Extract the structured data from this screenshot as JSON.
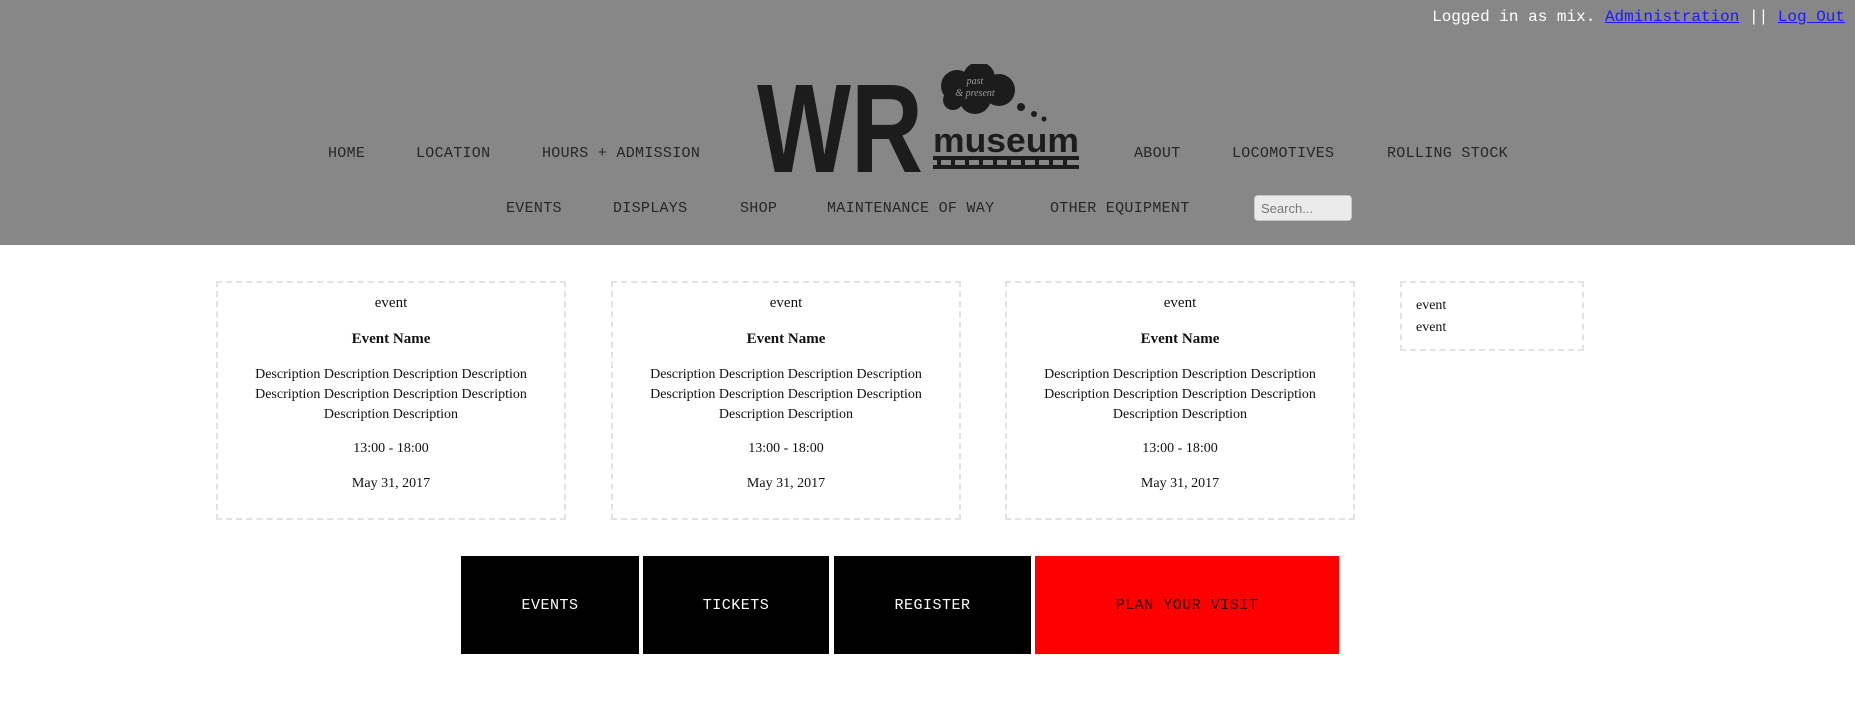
{
  "login": {
    "prefix": "Logged in as mix.",
    "admin_link": "Administration",
    "separator": "||",
    "logout_link": "Log Out"
  },
  "nav": {
    "row1_left": [
      "HOME",
      "LOCATION",
      "HOURS + ADMISSION"
    ],
    "row1_right": [
      "ABOUT",
      "LOCOMOTIVES",
      "ROLLING STOCK"
    ],
    "row2": [
      "EVENTS",
      "DISPLAYS",
      "SHOP",
      "MAINTENANCE OF WAY",
      "OTHER EQUIPMENT"
    ]
  },
  "logo": {
    "letters": "WR",
    "cloud_line1": "past",
    "cloud_line2": "& present",
    "word": "museum"
  },
  "search": {
    "placeholder": "Search..."
  },
  "events": [
    {
      "type": "event",
      "name": "Event Name",
      "description": "Description Description Description Description Description Description Description Description Description Description",
      "time": "13:00 - 18:00",
      "date": "May 31, 2017"
    },
    {
      "type": "event",
      "name": "Event Name",
      "description": "Description Description Description Description Description Description Description Description Description Description",
      "time": "13:00 - 18:00",
      "date": "May 31, 2017"
    },
    {
      "type": "event",
      "name": "Event Name",
      "description": "Description Description Description Description Description Description Description Description Description Description",
      "time": "13:00 - 18:00",
      "date": "May 31, 2017"
    }
  ],
  "side_list": [
    "event",
    "event"
  ],
  "cta": {
    "events": "EVENTS",
    "tickets": "TICKETS",
    "register": "REGISTER",
    "plan": "PLAN YOUR VISIT"
  },
  "colors": {
    "header_bg": "#878787",
    "cta_dark": "#000000",
    "cta_accent": "#ff0000",
    "link": "#1a1aff"
  }
}
